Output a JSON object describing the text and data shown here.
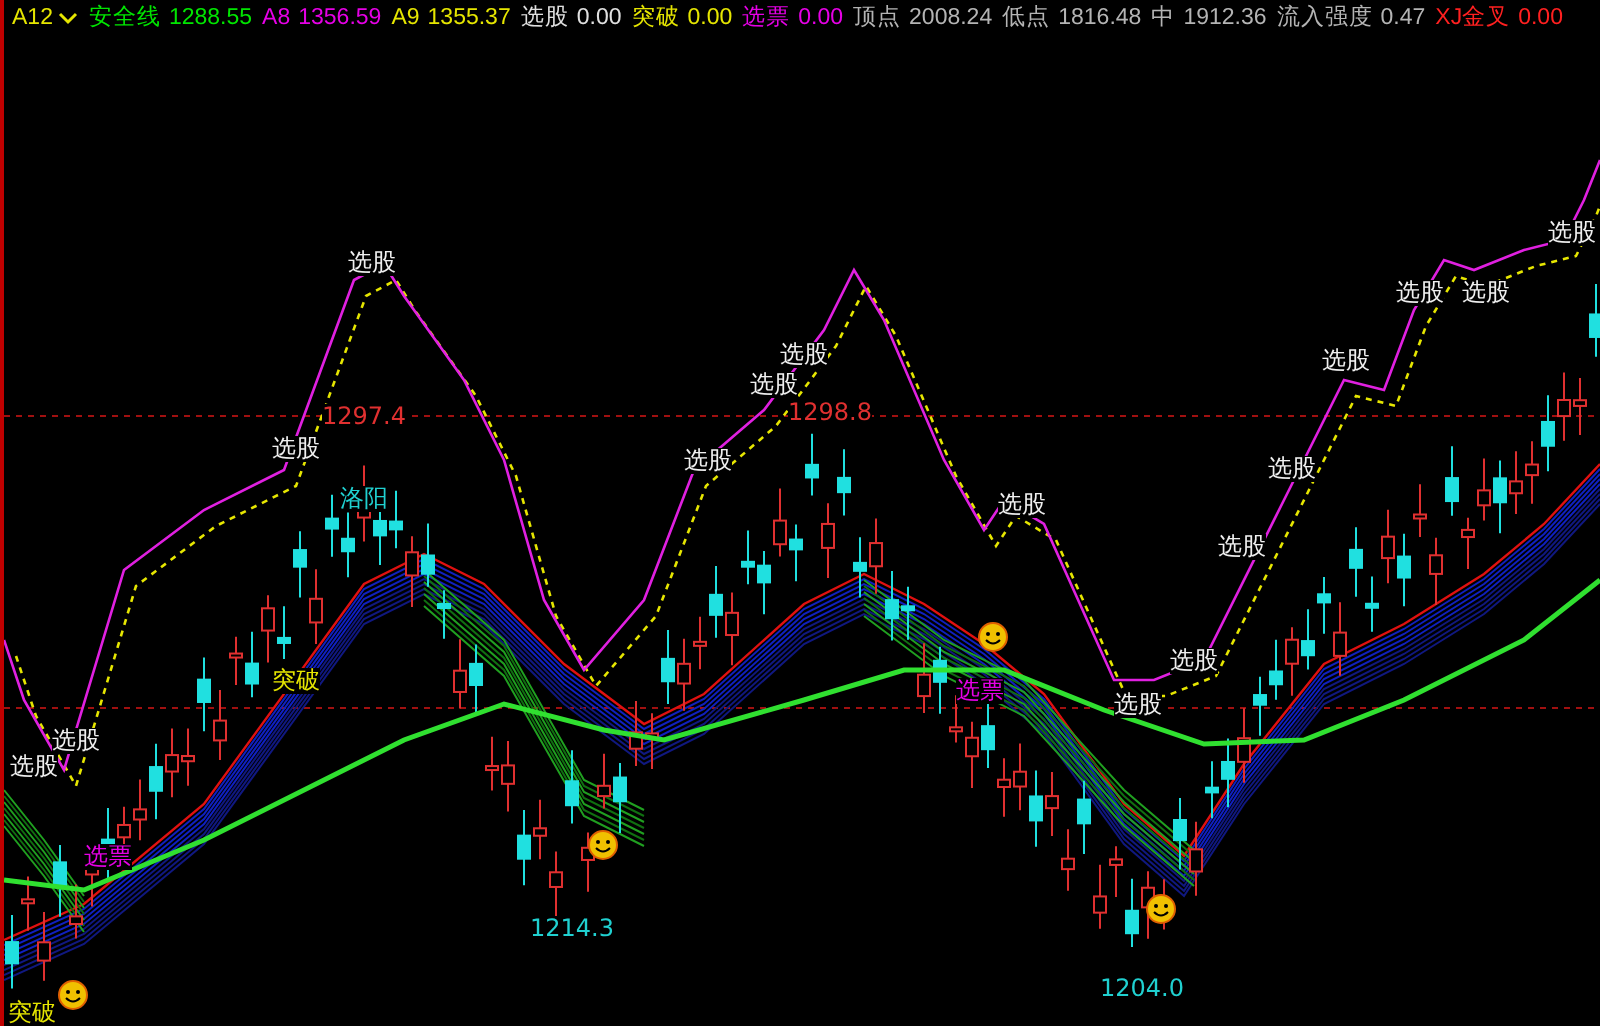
{
  "header": {
    "selector": "A12",
    "items": [
      {
        "label": "安全线",
        "value": "1288.55",
        "color": "#00e600"
      },
      {
        "label": "A8",
        "value": "1356.59",
        "color": "#e600e6"
      },
      {
        "label": "A9",
        "value": "1355.37",
        "color": "#e6e600"
      },
      {
        "label": "选股",
        "value": "0.00",
        "color": "#e0e0e0"
      },
      {
        "label": "突破",
        "value": "0.00",
        "color": "#e6e600"
      },
      {
        "label": "选票",
        "value": "0.00",
        "color": "#e600e6"
      },
      {
        "label": "顶点",
        "value": "2008.24",
        "color": "#b4b4b4"
      },
      {
        "label": "低点",
        "value": "1816.48",
        "color": "#b4b4b4"
      },
      {
        "label": "中",
        "value": "1912.36",
        "color": "#b4b4b4"
      },
      {
        "label": "流入强度",
        "value": "0.47",
        "color": "#b4b4b4"
      },
      {
        "label": "XJ金叉",
        "value": "0.00",
        "color": "#ff2020"
      }
    ]
  },
  "annotations": [
    {
      "text": "选股",
      "color": "#f0f0f0"
    },
    {
      "text": "选股",
      "color": "#f0f0f0"
    },
    {
      "text": "选股",
      "color": "#f0f0f0"
    },
    {
      "text": "选股",
      "color": "#f0f0f0"
    },
    {
      "text": "选股",
      "color": "#f0f0f0"
    },
    {
      "text": "选股",
      "color": "#f0f0f0"
    },
    {
      "text": "选股",
      "color": "#f0f0f0"
    },
    {
      "text": "选股",
      "color": "#f0f0f0"
    },
    {
      "text": "选股",
      "color": "#f0f0f0"
    },
    {
      "text": "选股",
      "color": "#f0f0f0"
    },
    {
      "text": "选股",
      "color": "#f0f0f0"
    },
    {
      "text": "选股",
      "color": "#f0f0f0"
    },
    {
      "text": "选股",
      "color": "#f0f0f0"
    },
    {
      "text": "选股",
      "color": "#f0f0f0"
    },
    {
      "text": "选股",
      "color": "#f0f0f0"
    },
    {
      "text": "选股",
      "color": "#f0f0f0"
    },
    {
      "text": "1297.4",
      "color": "#e03030"
    },
    {
      "text": "1298.8",
      "color": "#e03030"
    },
    {
      "text": "1214.3",
      "color": "#20d0d0"
    },
    {
      "text": "1204.0",
      "color": "#20d0d0"
    },
    {
      "text": "突破",
      "color": "#e6e600"
    },
    {
      "text": "突破",
      "color": "#e6e600"
    },
    {
      "text": "选票",
      "color": "#e600e6"
    },
    {
      "text": "选票",
      "color": "#e600e6"
    },
    {
      "text": "洛阳",
      "color": "#20d0d0"
    }
  ]
}
